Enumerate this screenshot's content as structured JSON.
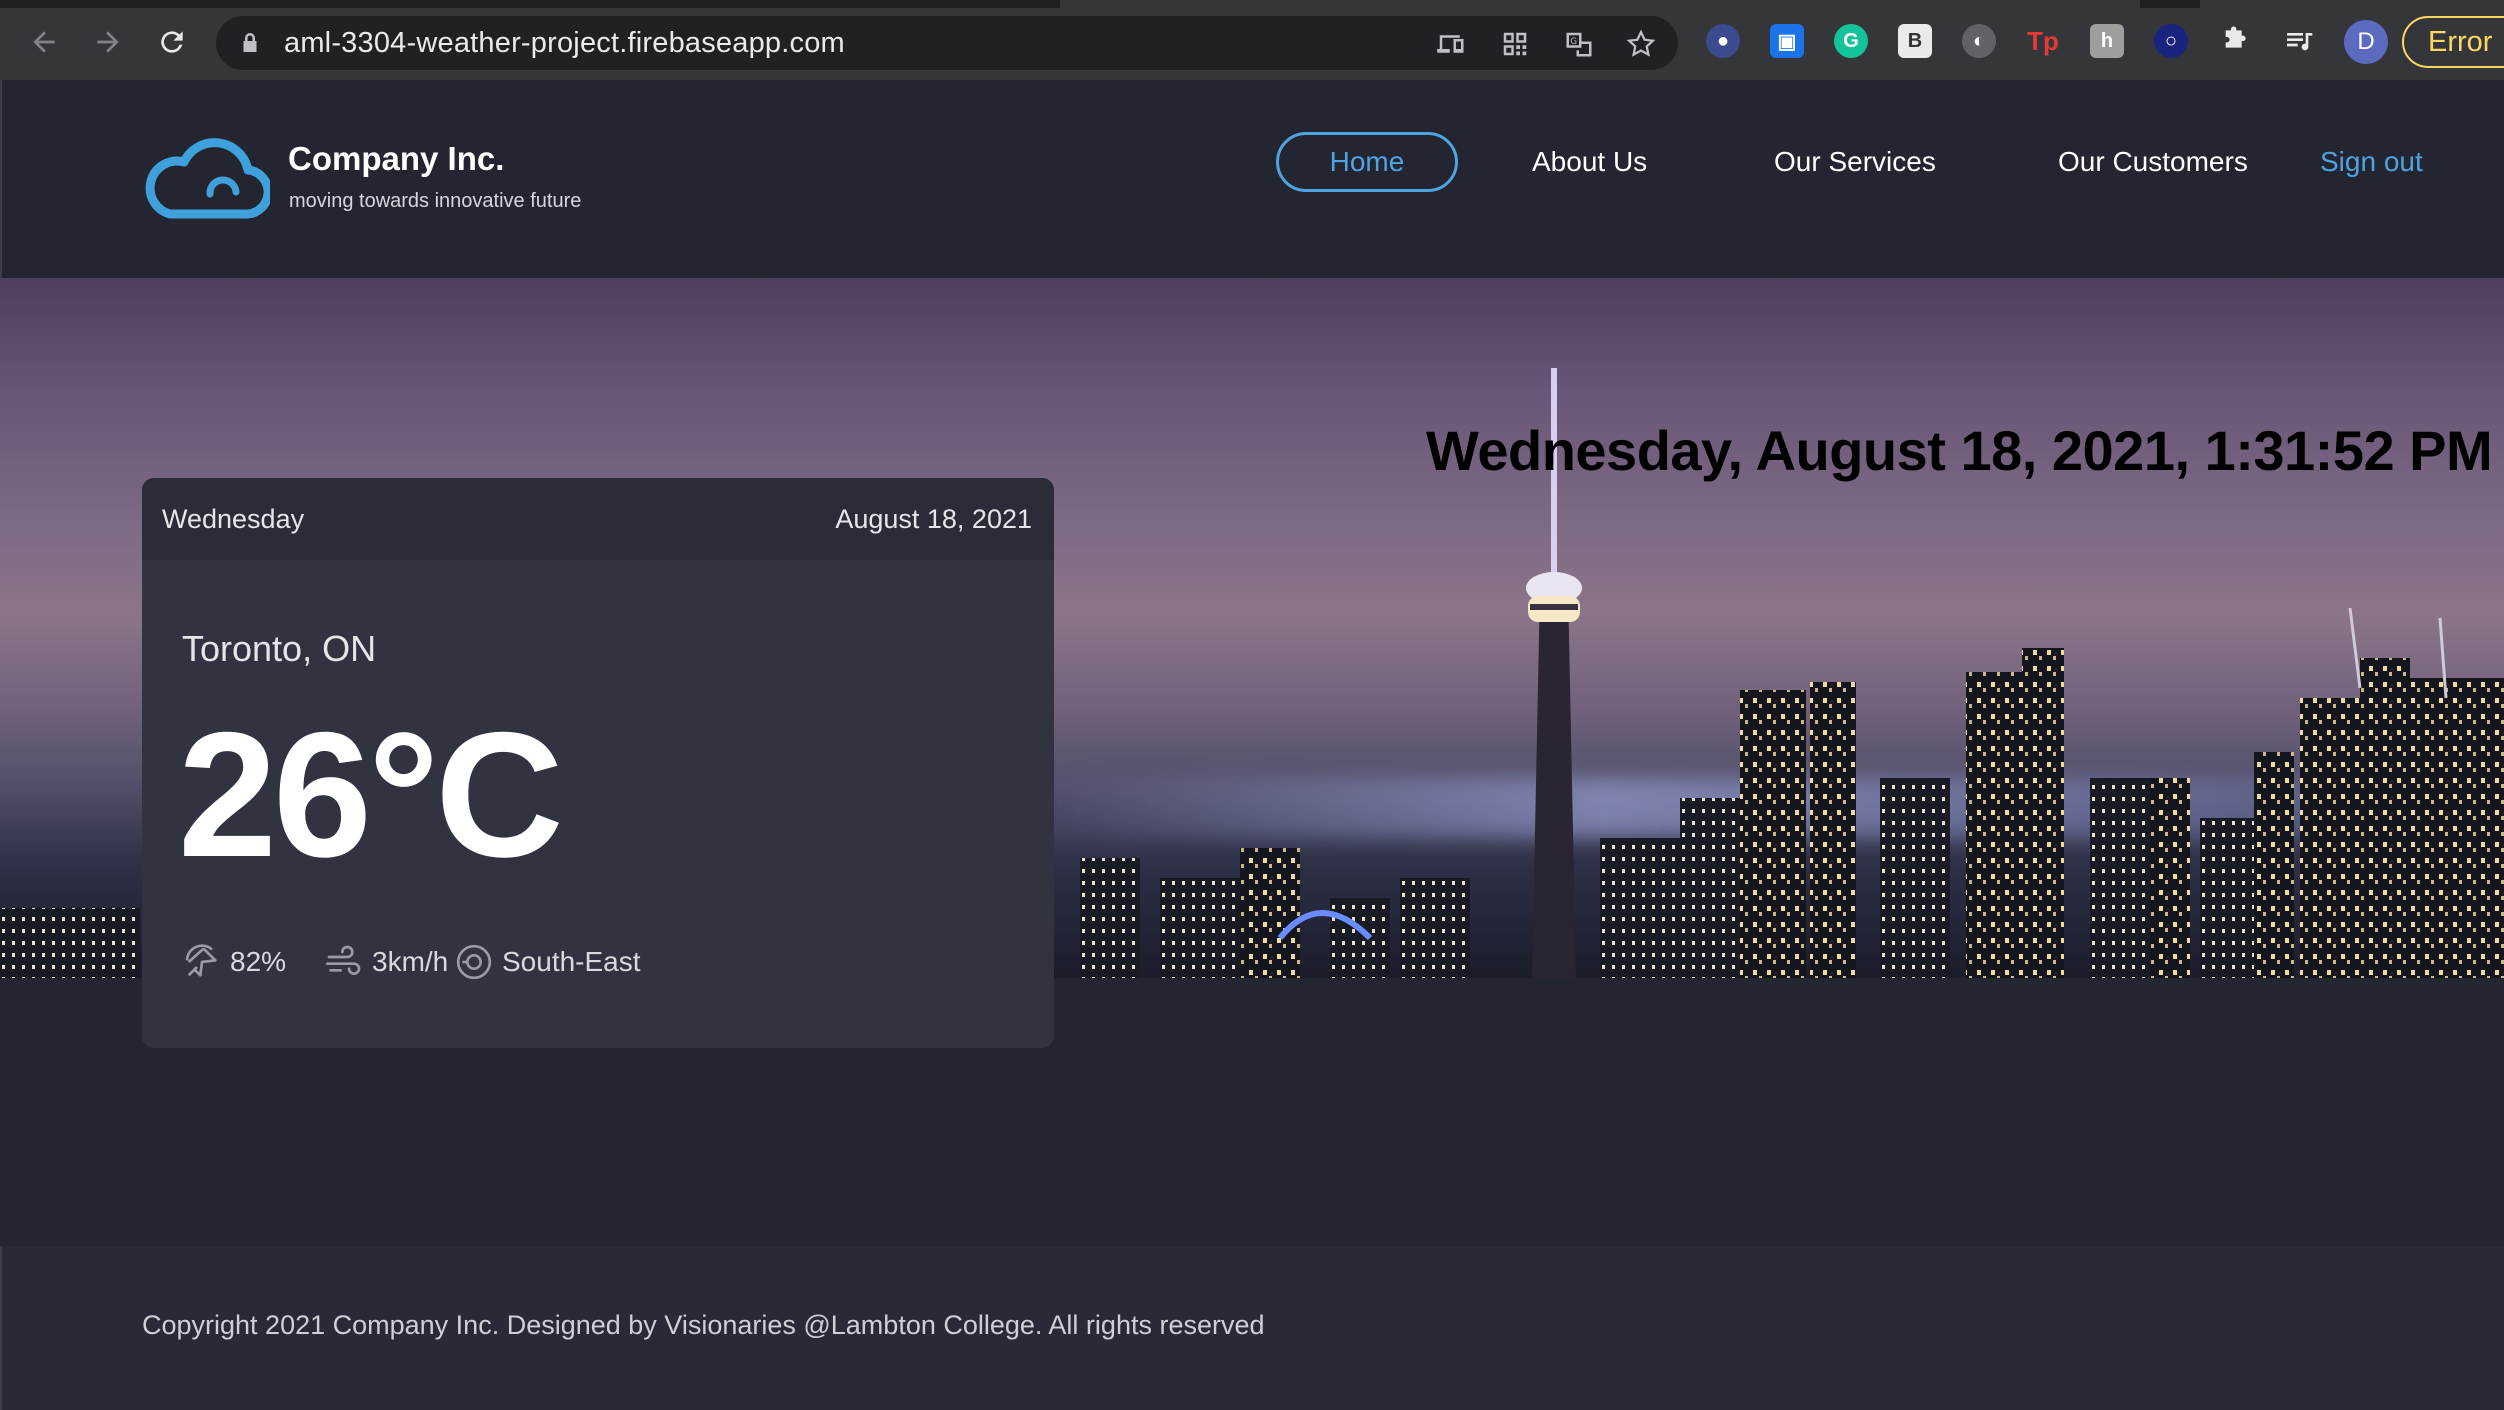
{
  "browser": {
    "url": "aml-3304-weather-project.firebaseapp.com",
    "profile_initial": "D",
    "error_label": "Error",
    "icons": [
      "back-arrow-icon",
      "forward-arrow-icon",
      "reload-icon",
      "lock-icon",
      "device-icon",
      "qr-icon",
      "translate-icon",
      "star-icon",
      "puzzle-icon",
      "media-queue-icon"
    ]
  },
  "header": {
    "brand": "Company Inc.",
    "tagline": "moving towards innovative future",
    "nav": {
      "home": "Home",
      "about": "About Us",
      "services": "Our Services",
      "customers": "Our Customers",
      "signout": "Sign out"
    },
    "accent_color": "#4fa3e0"
  },
  "hero": {
    "datetime": "Wednesday, August 18, 2021, 1:31:52 PM"
  },
  "weather": {
    "day": "Wednesday",
    "date": "August 18, 2021",
    "city": "Toronto, ON",
    "temperature": "26°C",
    "humidity": "82%",
    "wind_speed": "3km/h",
    "wind_direction": "South-East"
  },
  "footer": {
    "copyright": "Copyright 2021 Company Inc. Designed by Visionaries @Lambton College. All rights reserved"
  }
}
